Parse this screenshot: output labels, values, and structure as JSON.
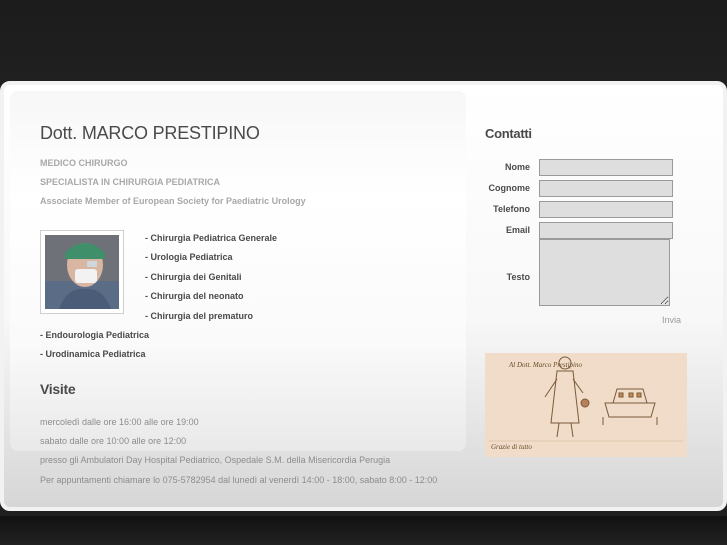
{
  "doctor": {
    "title": "Dott. MARCO PRESTIPINO",
    "role": "MEDICO CHIRURGO",
    "specialty": "SPECIALISTA IN CHIRURGIA PEDIATRICA",
    "membership": "Associate Member of European Society for Paediatric Urology"
  },
  "specialties": [
    "- Chirurgia Pediatrica Generale",
    "- Urologia Pediatrica",
    "- Chirurgia dei Genitali",
    "- Chirurgia del neonato",
    "- Chirurgia del prematuro",
    "- Endourologia Pediatrica",
    "- Urodinamica Pediatrica"
  ],
  "visits": {
    "title": "Visite",
    "lines": [
      "mercoledì dalle ore 16:00 alle ore 19:00",
      "sabato dalle ore 10:00 alle ore 12:00",
      "presso gli Ambulatori Day Hospital Pediatrico, Ospedale S.M. della Misericordia Perugia",
      "Per appuntamenti chiamare lo 075-5782954 dal lunedì al venerdì 14:00 - 18:00, sabato 8:00 - 12:00"
    ]
  },
  "contact": {
    "title": "Contatti",
    "labels": {
      "name": "Nome",
      "surname": "Cognome",
      "phone": "Telefono",
      "email": "Email",
      "text": "Testo"
    },
    "values": {
      "name": "",
      "surname": "",
      "phone": "",
      "email": "",
      "text": ""
    },
    "submit": "Invia"
  },
  "drawing": {
    "caption_top": "Al Dott. Marco Prestipino",
    "caption_bottom": "Grazie di tutto"
  },
  "colors": {
    "background": "#1f1f1f",
    "card": "#ffffff",
    "text_dark": "#4a4a4a",
    "text_muted": "#a8a8a8",
    "field_bg": "#dedede"
  }
}
